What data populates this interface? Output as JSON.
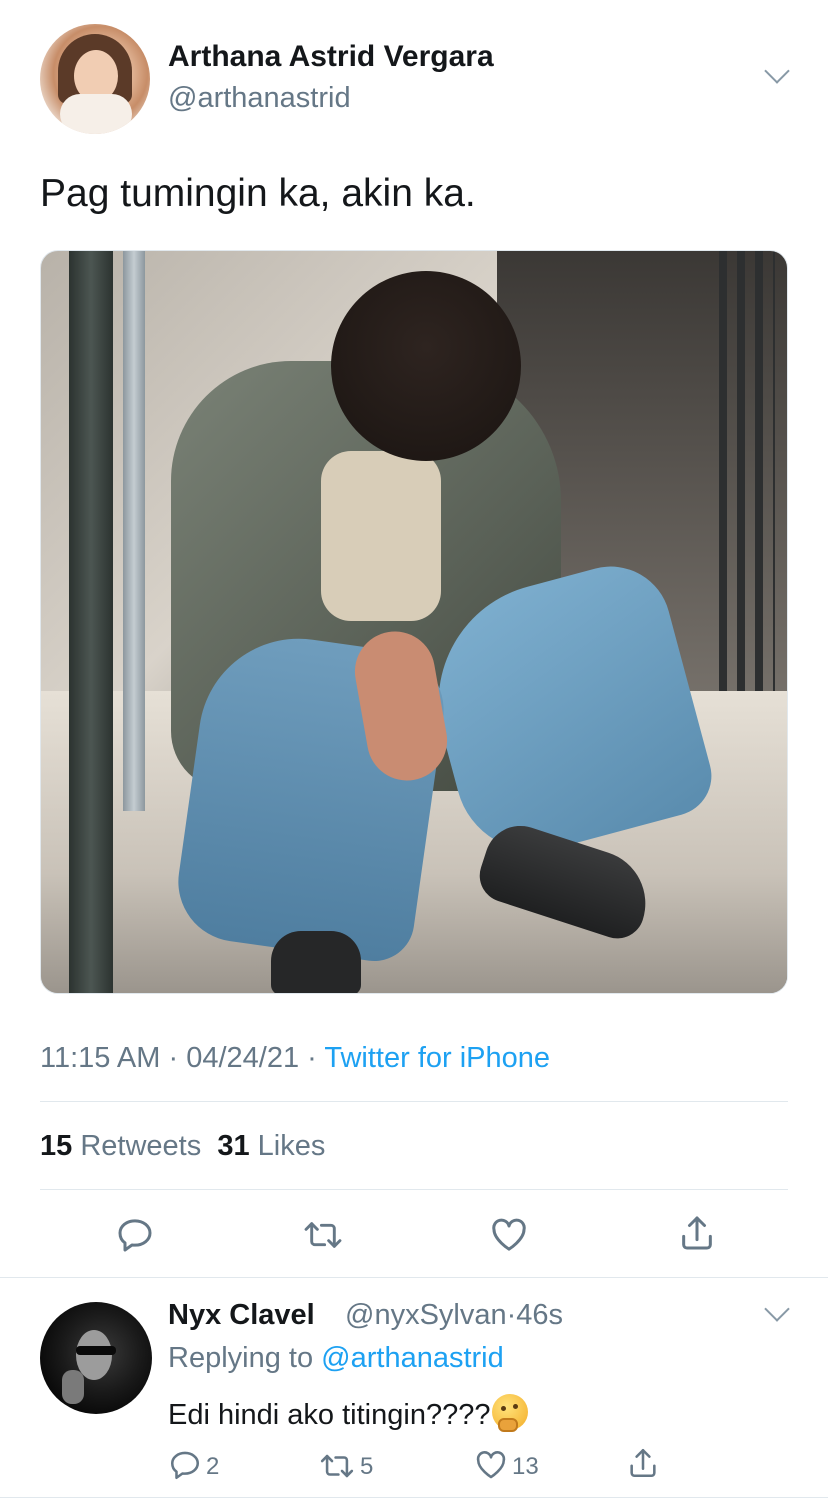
{
  "main_tweet": {
    "author_name": "Arthana Astrid Vergara",
    "author_handle": "@arthanastrid",
    "text": "Pag tumingin ka, akin ka.",
    "time": "11:15 AM",
    "separator": "·",
    "date": "04/24/21",
    "source": "Twitter for iPhone",
    "retweets_count": "15",
    "retweets_label": "Retweets",
    "likes_count": "31",
    "likes_label": "Likes",
    "actions": {
      "reply_icon": "reply-bubble-icon",
      "retweet_icon": "retweet-icon",
      "like_icon": "heart-icon",
      "share_icon": "share-icon"
    }
  },
  "reply": {
    "author_name": "Nyx Clavel",
    "author_handle": "@nyxSylvan",
    "separator": "·",
    "age": "46s",
    "replying_to_label": "Replying to",
    "replying_to_handle": "@arthanastrid",
    "text": "Edi hindi ako titingin????",
    "emoji": "thinking-face",
    "reply_count": "2",
    "retweet_count": "5",
    "like_count": "13"
  },
  "colors": {
    "text_primary": "#14171a",
    "text_secondary": "#657786",
    "accent_blue": "#1da1f2",
    "divider": "#e1e8ed"
  }
}
